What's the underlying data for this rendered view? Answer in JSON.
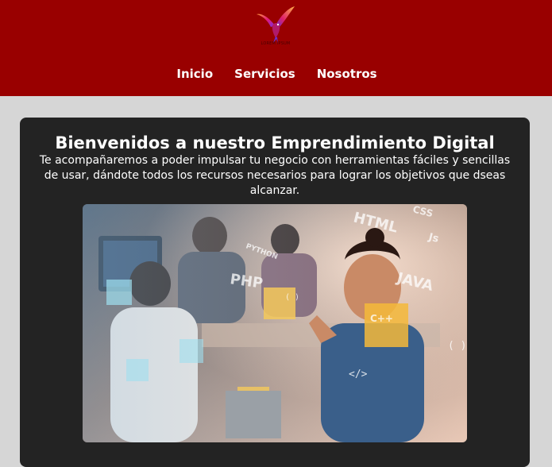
{
  "header": {
    "logo_text": "LOREM IPSUM",
    "nav": [
      {
        "label": "Inicio"
      },
      {
        "label": "Servicios"
      },
      {
        "label": "Nosotros"
      }
    ]
  },
  "main": {
    "title": "Bienvenidos a nuestro Emprendimiento Digital",
    "description": "Te acompañaremos a poder impulsar tu negocio con herramientas fáciles y sencillas de usar, dándote todos los recursos necesarios para lograr los objetivos que dseas alcanzar."
  },
  "hero_image": {
    "words": [
      "HTML",
      "CSS",
      "Js",
      "JAVA",
      "C++",
      "PHP",
      "PYTHON"
    ]
  },
  "colors": {
    "header_bg": "#990000",
    "page_bg": "#d6d6d6",
    "card_bg": "#232323",
    "text": "#ffffff"
  }
}
